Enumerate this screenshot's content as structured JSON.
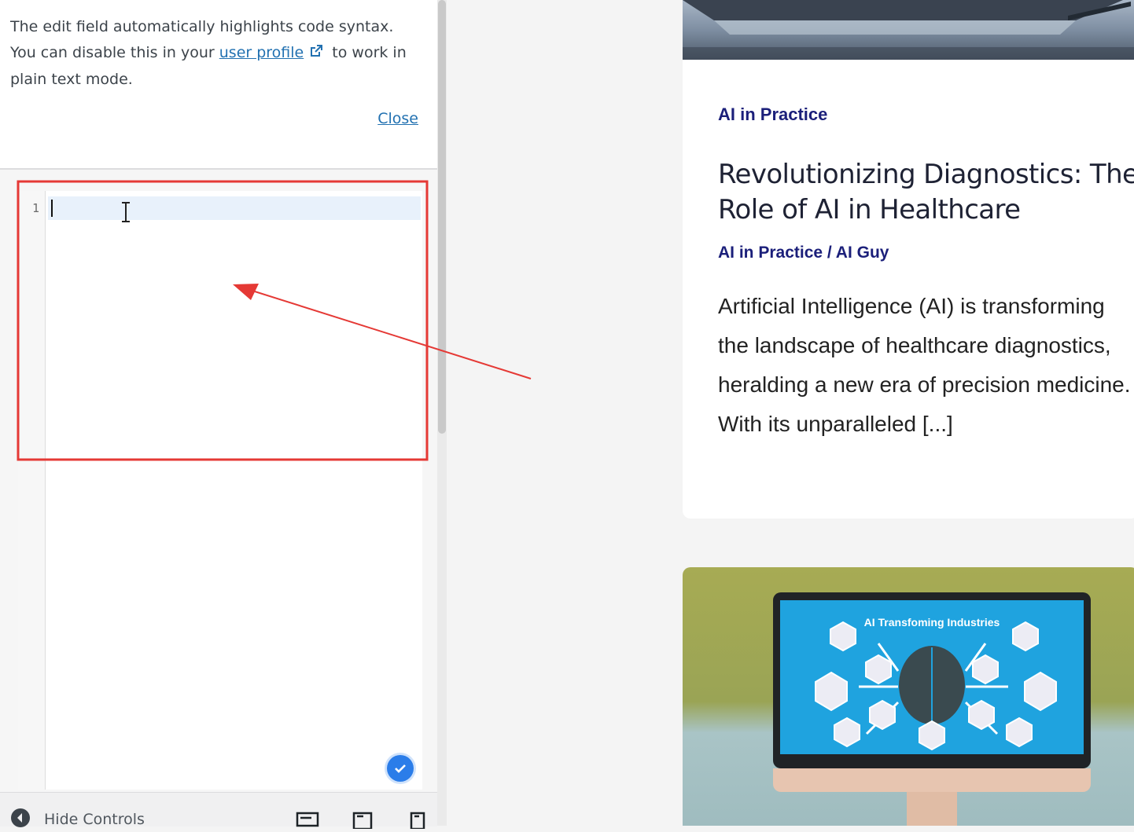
{
  "notice": {
    "text_before": "The edit field automatically highlights code syntax. You can disable this in your",
    "link_label": "user profile",
    "text_after": "to work in plain text mode.",
    "close_label": "Close"
  },
  "editor": {
    "line_number": "1",
    "content": ""
  },
  "footer": {
    "hide_controls_label": "Hide Controls",
    "devices": [
      "desktop",
      "tablet",
      "mobile"
    ]
  },
  "preview": {
    "card1": {
      "category": "AI in Practice",
      "title": "Revolutionizing Diagnostics: The Role of AI in Healthcare",
      "meta": "AI in Practice / AI Guy",
      "excerpt": "Artificial Intelligence (AI) is transforming the landscape of healthcare diagnostics, heralding a new era of precision medicine. With its unparalleled [...]"
    },
    "card2": {
      "screen_title": "AI Transfoming Industries"
    }
  },
  "colors": {
    "accent": "#2271b1",
    "annotation": "#e53935",
    "category_text": "#1b1f7a"
  },
  "icons": [
    "external-link-icon",
    "text-cursor-icon",
    "checkmark-icon",
    "collapse-arrow-icon",
    "desktop-icon",
    "tablet-icon",
    "mobile-icon"
  ]
}
